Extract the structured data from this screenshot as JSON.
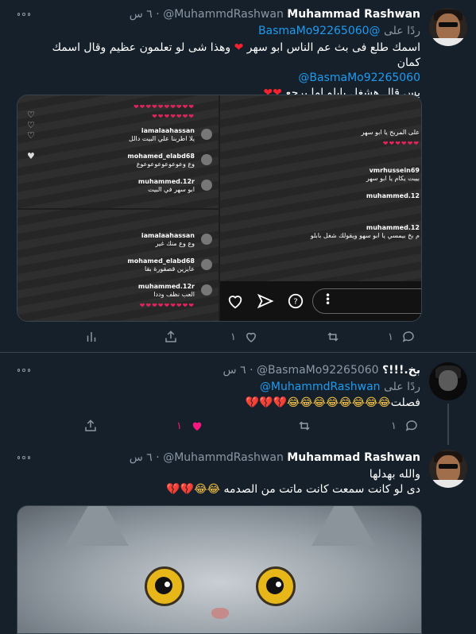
{
  "tweets": [
    {
      "name": "Muhammad Rashwan",
      "handle": "@MuhammdRashwan",
      "time": "٦ س",
      "reply_prefix": "ردًا على",
      "reply_to": "@BasmaMo92265060",
      "lines": [
        "اسمك طلع فى بث عم الناس ابو سهر",
        "وهذا شى لو تعلمون عظيم وقال اسمك",
        "كمان",
        "@BasmaMo92265060",
        "بس قال هشغل بابلو اما يرجع"
      ],
      "counts": {
        "reply": "١",
        "retweet": "",
        "like": "١"
      },
      "media": {
        "comments_left_top": [
          {
            "user": "muhammed.12r",
            "text": "العب نظف وددا"
          },
          {
            "user": "iamalaahassan",
            "text": "يلا اطربنا علي البيت دالل"
          },
          {
            "user": "mohamed_elabd68",
            "text": "وع وعوعوعوعوعوعوع"
          },
          {
            "user": "muhammed.12r",
            "text": "ابو سهر في البيت"
          }
        ],
        "comments_left_bottom": [
          {
            "user": "iamalaahassan",
            "text": "وع وع منك غير"
          },
          {
            "user": "mohamed_elabd68",
            "text": "عايزين قصقورة بقا"
          },
          {
            "user": "muhammed.12r",
            "text": "العب نظف وددا"
          }
        ],
        "comments_right": [
          {
            "user": "",
            "text": "على المربح يا ابو سهر"
          },
          {
            "user": "vmrhussein69",
            "text": "بيبت يكام يا ابو سهر"
          },
          {
            "user": "muhammed.12",
            "text": ""
          },
          {
            "user": "muhammed.12",
            "text": "م بخ بيمسي يا ابو سهو ويقولك شغل بابلو"
          }
        ]
      }
    },
    {
      "name": "بخ.!!!؟",
      "handle": "@BasmaMo92265060",
      "time": "٦ س",
      "reply_prefix": "ردًا على",
      "reply_to": "@MuhammdRashwan",
      "lines": [
        "فصلت"
      ],
      "counts": {
        "reply": "١",
        "retweet": "",
        "like": "١"
      }
    },
    {
      "name": "Muhammad Rashwan",
      "handle": "@MuhammdRashwan",
      "time": "٦ س",
      "lines": [
        "والله بهدلها",
        "دى لو كانت سمعت كانت ماتت من الصدمه"
      ]
    }
  ],
  "icons": {
    "reply": "reply-icon",
    "retweet": "retweet-icon",
    "like": "heart-icon",
    "share": "share-icon",
    "analytics": "analytics-icon",
    "more": "more-icon"
  },
  "colors": {
    "background": "#15202b",
    "link": "#1d9bf0",
    "like_active": "#f91880",
    "muted": "#8b98a5"
  }
}
